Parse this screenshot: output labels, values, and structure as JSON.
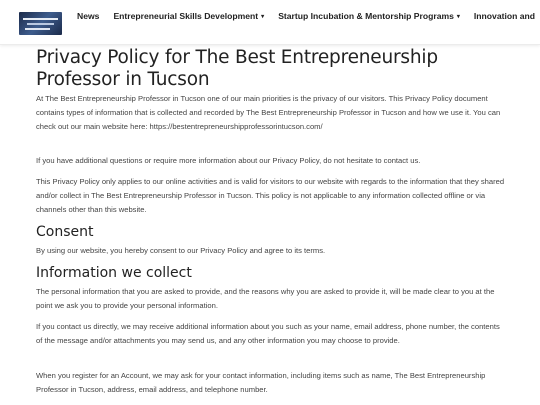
{
  "nav": {
    "logo_alt": "The Best Entrepreneurship Professor",
    "items": [
      {
        "label": "News",
        "has_dropdown": false
      },
      {
        "label": "Entrepreneurial Skills Development",
        "has_dropdown": true
      },
      {
        "label": "Startup Incubation & Mentorship Programs",
        "has_dropdown": true
      },
      {
        "label": "Innovation and",
        "has_dropdown": false
      }
    ],
    "dropdown_glyph": "▾"
  },
  "page": {
    "title": "Privacy Policy for The Best Entrepreneurship Professor in Tucson",
    "intro": "At The Best Entrepreneurship Professor in Tucson one of our main priorities is the privacy of our visitors. This Privacy Policy document contains types of information that is collected and recorded by The Best Entrepreneurship Professor in Tucson and how we use it. You can check out our main website here: https://bestentrepreneurshipprofessorintucson.com/",
    "questions": "If you have additional questions or require more information about our Privacy Policy, do not hesitate to contact us.",
    "scope": "This Privacy Policy only applies to our online activities and is valid for visitors to our website with regards to the information that they shared and/or collect in The Best Entrepreneurship Professor in Tucson. This policy is not applicable to any information collected offline or via channels other than this website.",
    "consent_heading": "Consent",
    "consent_text": "By using our website, you hereby consent to our Privacy Policy and agree to its terms.",
    "info_heading": "Information we collect",
    "info_p1": "The personal information that you are asked to provide, and the reasons why you are asked to provide it, will be made clear to you at the point we ask you to provide your personal information.",
    "info_p2": "If you contact us directly, we may receive additional information about you such as your name, email address, phone number, the contents of the message and/or attachments you may send us, and any other information you may choose to provide.",
    "info_p3": "When you register for an Account, we may ask for your contact information, including items such as name, The Best Entrepreneurship Professor in Tucson, address, email address, and telephone number."
  }
}
